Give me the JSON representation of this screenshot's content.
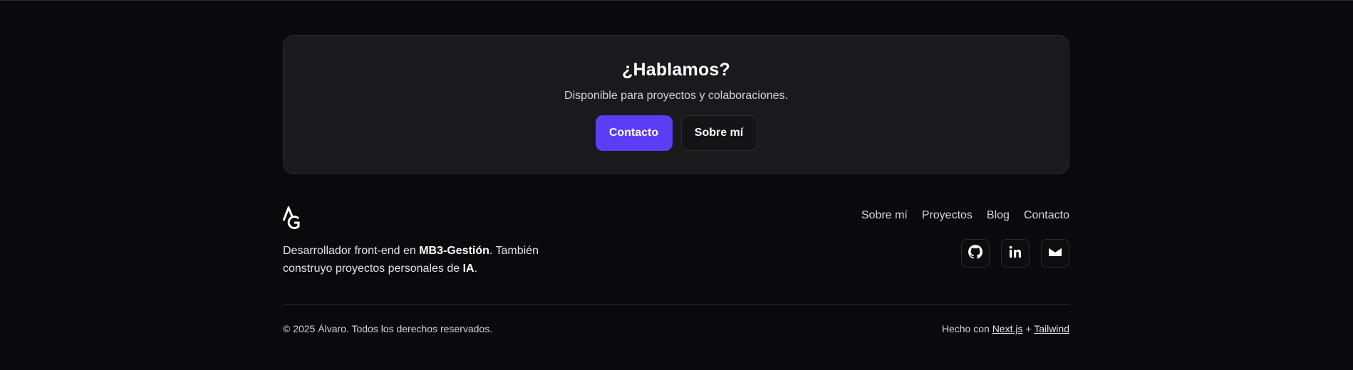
{
  "cta": {
    "title": "¿Hablamos?",
    "subtitle": "Disponible para proyectos y colaboraciones.",
    "primary_button": "Contacto",
    "secondary_button": "Sobre mí"
  },
  "footer": {
    "logo_icon": "ag-monogram-logo",
    "nav": [
      "Sobre mí",
      "Proyectos",
      "Blog",
      "Contacto"
    ],
    "description": {
      "part1": "Desarrollador front-end en ",
      "company": "MB3-Gestión",
      "part2": ". También construyo proyectos personales de ",
      "topic": "IA",
      "part3": "."
    },
    "socials": [
      "github-icon",
      "linkedin-icon",
      "mail-icon"
    ],
    "copyright": "© 2025 Álvaro. Todos los derechos reservados.",
    "made_with": {
      "prefix": "Hecho con ",
      "tech1": "Next.js",
      "separator": " + ",
      "tech2": "Tailwind"
    }
  },
  "colors": {
    "background": "#0a0a0c",
    "card": "#1a1a1d",
    "accent": "#5b3df5"
  }
}
